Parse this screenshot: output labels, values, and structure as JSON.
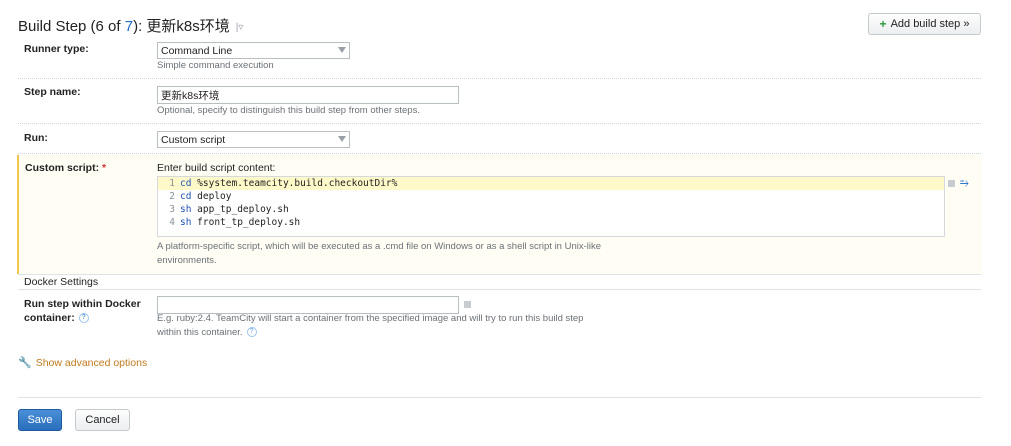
{
  "header": {
    "title_prefix": "Build Step (6 of ",
    "title_total": "7",
    "title_suffix": "): 更新k8s环境",
    "add_step_label": "Add build step »"
  },
  "runner_type": {
    "label": "Runner type:",
    "value": "Command Line",
    "hint": "Simple command execution"
  },
  "step_name": {
    "label": "Step name:",
    "value": "更新k8s环境",
    "hint": "Optional, specify to distinguish this build step from other steps."
  },
  "run": {
    "label": "Run:",
    "value": "Custom script"
  },
  "custom_script": {
    "label": "Custom script:",
    "required_marker": "*",
    "intro": "Enter build script content:",
    "lines": [
      {
        "num": "1",
        "kw": "cd",
        "rest": " %system.teamcity.build.checkoutDir%"
      },
      {
        "num": "2",
        "kw": "cd",
        "rest": " deploy"
      },
      {
        "num": "3",
        "kw": "sh",
        "rest": " app_tp_deploy.sh"
      },
      {
        "num": "4",
        "kw": "sh",
        "rest": " front_tp_deploy.sh"
      }
    ],
    "hint_line1": "A platform-specific script, which will be executed as a .cmd file on Windows or as a shell script in Unix-like",
    "hint_line2": "environments."
  },
  "docker": {
    "section_title": "Docker Settings",
    "label_line1": "Run step within Docker",
    "label_line2": "container:",
    "value": "",
    "hint_line1": "E.g. ruby:2.4. TeamCity will start a container from the specified image and will try to run this build step",
    "hint_line2": "within this container."
  },
  "advanced_link": "Show advanced options",
  "footer": {
    "save_label": "Save",
    "cancel_label": "Cancel"
  }
}
